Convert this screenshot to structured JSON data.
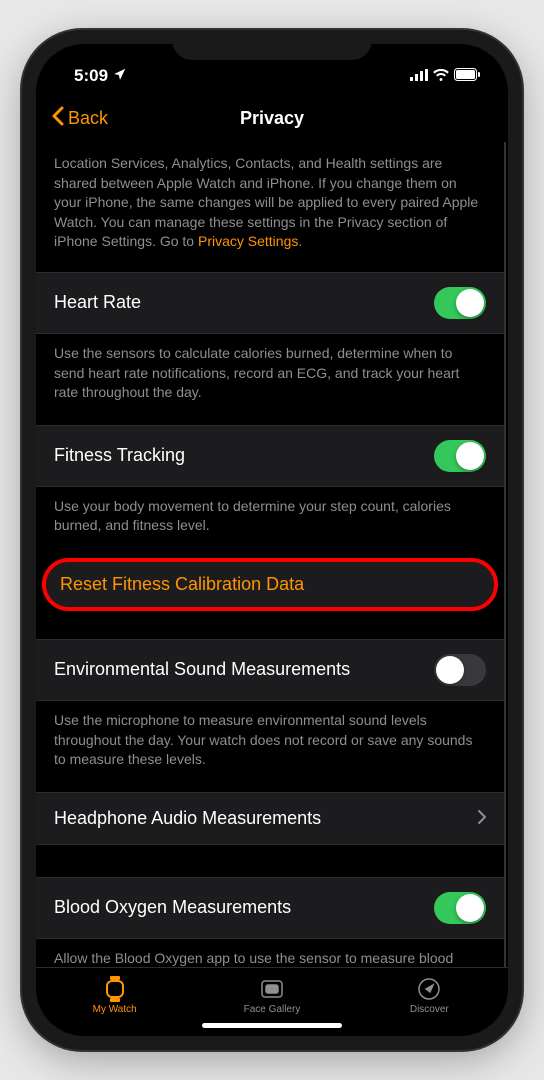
{
  "statusBar": {
    "time": "5:09",
    "locationIcon": "location-icon"
  },
  "navBar": {
    "backLabel": "Back",
    "title": "Privacy"
  },
  "intro": {
    "text": "Location Services, Analytics, Contacts, and Health settings are shared between Apple Watch and iPhone. If you change them on your iPhone, the same changes will be applied to every paired Apple Watch. You can manage these settings in the Privacy section of iPhone Settings. Go to ",
    "linkText": "Privacy Settings",
    "period": "."
  },
  "settings": {
    "heartRate": {
      "label": "Heart Rate",
      "description": "Use the sensors to calculate calories burned, determine when to send heart rate notifications, record an ECG, and track your heart rate throughout the day.",
      "enabled": true
    },
    "fitnessTracking": {
      "label": "Fitness Tracking",
      "description": "Use your body movement to determine your step count, calories burned, and fitness level.",
      "enabled": true
    },
    "resetCalibration": {
      "label": "Reset Fitness Calibration Data"
    },
    "environmentalSound": {
      "label": "Environmental Sound Measurements",
      "description": "Use the microphone to measure environmental sound levels throughout the day. Your watch does not record or save any sounds to measure these levels.",
      "enabled": false
    },
    "headphoneAudio": {
      "label": "Headphone Audio Measurements"
    },
    "bloodOxygen": {
      "label": "Blood Oxygen Measurements",
      "description": "Allow the Blood Oxygen app to use the sensor to measure blood oxygen levels throughout the day and take on-demand",
      "enabled": true
    }
  },
  "tabBar": {
    "myWatch": "My Watch",
    "faceGallery": "Face Gallery",
    "discover": "Discover"
  }
}
